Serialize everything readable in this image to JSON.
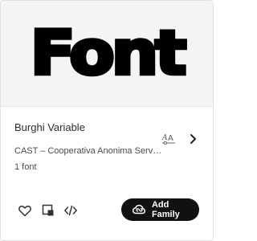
{
  "preview": {
    "sample_text": "Font"
  },
  "family": {
    "name": "Burghi Variable",
    "foundry": "CAST – Cooperativa Anonima Servizi Tipografici",
    "count": "1 font"
  },
  "icons": {
    "language": "language-glyphs-icon",
    "chevron": "chevron-right-icon",
    "heart": "heart-icon",
    "add_to_project": "add-to-project-icon",
    "embed": "code-embed-icon",
    "creative_cloud": "creative-cloud-icon"
  },
  "actions": {
    "add_family_label": "Add Family"
  },
  "colors": {
    "preview_background": "#f4f4f4",
    "button_background": "#111111",
    "button_text": "#ffffff"
  }
}
